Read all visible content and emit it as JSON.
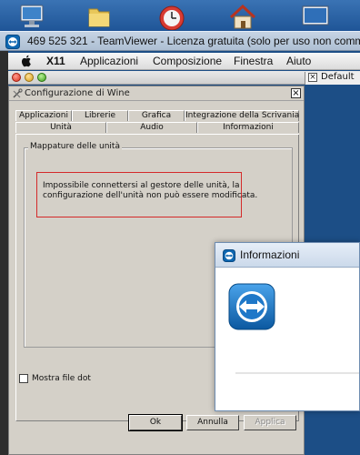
{
  "desktop": {
    "icons": [
      "monitor-icon",
      "folder-icon",
      "clock-icon",
      "home-icon",
      "screen-icon"
    ]
  },
  "teamviewer": {
    "title": "469 525 321 - TeamViewer - Licenza gratuita (solo per uso non comm"
  },
  "menubar": {
    "items": [
      "X11",
      "Applicazioni",
      "Composizione",
      "Finestra",
      "Aiuto"
    ]
  },
  "mac_window": {
    "default_label": "Default"
  },
  "wine_dialog": {
    "title": "Configurazione di Wine",
    "close_symbol": "×",
    "tabs_row1": [
      "Applicazioni",
      "Librerie",
      "Grafica",
      "Integrazione della Scrivania"
    ],
    "tabs_row2": [
      "Unità",
      "Audio",
      "Informazioni"
    ],
    "active_tab": "Unità",
    "group_label": "Mappature delle unità",
    "error_lines": [
      "Impossibile connettersi al gestore delle unità, la",
      "configurazione dell'unità non può essere modificata."
    ],
    "checkbox_label": "Mostra file dot",
    "checkbox_checked": false,
    "buttons": {
      "ok": "Ok",
      "cancel": "Annulla",
      "apply": "Applica"
    }
  },
  "info_dialog": {
    "title": "Informazioni"
  },
  "colors": {
    "teamviewer_blue": "#0e67b1",
    "error_border": "#d42a2a",
    "desktop": "#1c4e86"
  }
}
